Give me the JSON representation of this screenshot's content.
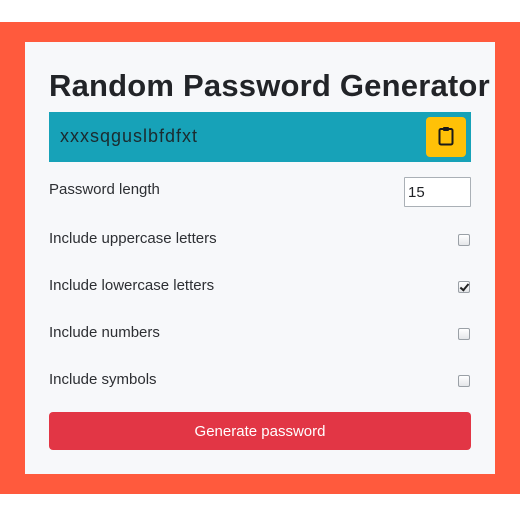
{
  "app": {
    "title": "Random Password Generator"
  },
  "password": {
    "value": "xxxsqguslbfdfxt"
  },
  "options": {
    "length_label": "Password length",
    "length_value": "15",
    "uppercase_label": "Include uppercase letters",
    "uppercase_checked": false,
    "lowercase_label": "Include lowercase letters",
    "lowercase_checked": true,
    "numbers_label": "Include numbers",
    "numbers_checked": false,
    "symbols_label": "Include symbols",
    "symbols_checked": false
  },
  "actions": {
    "generate_label": "Generate password",
    "copy_icon": "clipboard-icon"
  },
  "colors": {
    "background": "#ff5a3d",
    "card": "#f7f8fa",
    "password_bar": "#17a2b8",
    "copy_button": "#ffc107",
    "generate_button": "#e23645"
  }
}
